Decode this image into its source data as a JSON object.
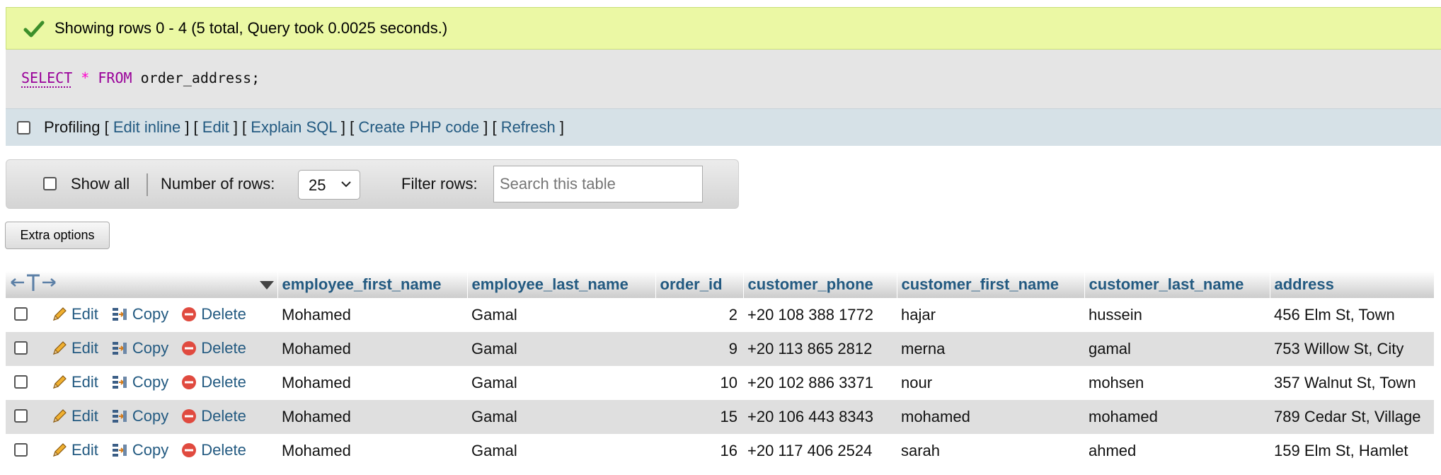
{
  "success": {
    "message": "Showing rows 0 - 4 (5 total, Query took 0.0025 seconds.)"
  },
  "sql": {
    "select": "SELECT",
    "star": "*",
    "from": "FROM",
    "rest": "order_address;"
  },
  "profiling": {
    "label": "Profiling",
    "links": [
      "Edit inline",
      "Edit",
      "Explain SQL",
      "Create PHP code",
      "Refresh"
    ]
  },
  "nav": {
    "show_all": "Show all",
    "rows_label": "Number of rows:",
    "rows_value": "25",
    "filter_label": "Filter rows:",
    "filter_placeholder": "Search this table"
  },
  "extra_options": "Extra options",
  "actions": {
    "edit": "Edit",
    "copy": "Copy",
    "delete": "Delete"
  },
  "table": {
    "columns": [
      "employee_first_name",
      "employee_last_name",
      "order_id",
      "customer_phone",
      "customer_first_name",
      "customer_last_name",
      "address"
    ],
    "rows": [
      [
        "Mohamed",
        "Gamal",
        "2",
        "+20 108 388 1772",
        "hajar",
        "hussein",
        "456 Elm St, Town"
      ],
      [
        "Mohamed",
        "Gamal",
        "9",
        "+20 113 865 2812",
        "merna",
        "gamal",
        "753 Willow St, City"
      ],
      [
        "Mohamed",
        "Gamal",
        "10",
        "+20 102 886 3371",
        "nour",
        "mohsen",
        "357 Walnut St, Town"
      ],
      [
        "Mohamed",
        "Gamal",
        "15",
        "+20 106 443 8343",
        "mohamed",
        "mohamed",
        "789 Cedar St, Village"
      ],
      [
        "Mohamed",
        "Gamal",
        "16",
        "+20 117 406 2524",
        "sarah",
        "ahmed",
        "159 Elm St, Hamlet"
      ]
    ]
  },
  "colors": {
    "link": "#235a81",
    "success_bg": "#ebf8a4",
    "delete_red": "#e04a3f"
  },
  "icons": [
    "check-icon",
    "chevron-down-icon",
    "column-arrows-icon",
    "sort-triangle-icon",
    "pencil-icon",
    "copy-icon",
    "delete-icon"
  ]
}
